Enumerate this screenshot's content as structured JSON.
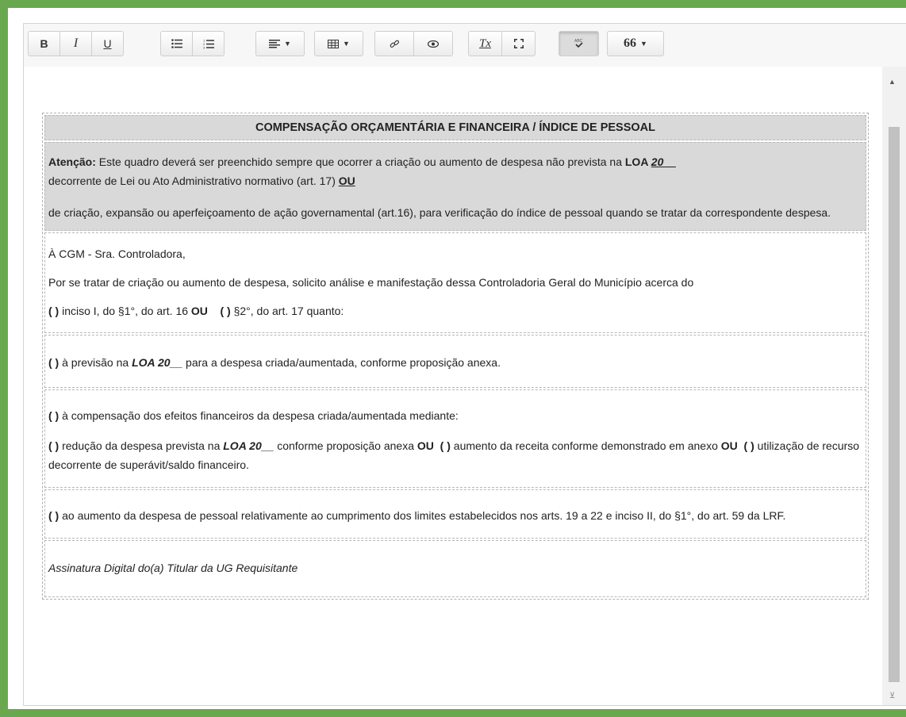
{
  "toolbar": {
    "bold": "B",
    "italic": "I",
    "underline": "U",
    "bulleted_list_icon": "list-ul-icon",
    "numbered_list_icon": "list-ol-icon",
    "align_icon": "align-left-icon",
    "table_icon": "table-icon",
    "link_icon": "link-icon",
    "preview_icon": "eye-icon",
    "clear_format": "Tx",
    "fullscreen_icon": "expand-icon",
    "spellcheck_icon": "spellcheck-icon",
    "quote": "66"
  },
  "document": {
    "title": "COMPENSAÇÃO ORÇAMENTÁRIA E FINANCEIRA / ÍNDICE DE PESSOAL",
    "attention": {
      "label": "Atenção:",
      "text1": " Este quadro deverá ser preenchido sempre que ocorrer a criação ou aumento de despesa não prevista na ",
      "loa_label": "LOA ",
      "loa_year": "20__",
      "text2": "decorrente de Lei ou Ato Administrativo normativo (art. 17)  ",
      "ou": "OU",
      "paragraph2": "de criação, expansão ou aperfeiçoamento de ação governamental (art.16), para verificação do índice de pessoal quando se tratar da correspondente despesa."
    },
    "request": {
      "salutation": "À CGM - Sra. Controladora,",
      "intro": "Por se tratar de criação ou aumento de despesa, solicito análise e manifestação dessa Controladoria Geral do Município acerca do",
      "opt_a_box": "( )",
      "opt_a": " inciso I, do §1°, do art. 16   ",
      "or": "OU",
      "opt_b_box": "( )",
      "opt_b": " §2°, do art. 17 quanto:"
    },
    "forecast": {
      "box": "( )",
      "text1": " à previsão na ",
      "loa": "LOA 20__",
      "text2": "  para a despesa criada/aumentada, conforme proposição anexa."
    },
    "compensation": {
      "box": "( )",
      "line1": " à compensação dos efeitos financeiros da despesa criada/aumentada mediante:",
      "box2": "( )",
      "text_a": " redução da despesa prevista na ",
      "loa": "LOA 20__",
      "text_b": " conforme proposição anexa  ",
      "or1": "OU",
      "box3": "(  )",
      "text_c": " aumento da receita conforme demonstrado em anexo   ",
      "or2": "OU",
      "box4": "( )",
      "text_d": " utilização de recurso decorrente de superávit/saldo financeiro."
    },
    "personnel": {
      "box": "( )",
      "text": " ao aumento da despesa de pessoal relativamente ao cumprimento dos limites estabelecidos nos arts. 19 a 22 e inciso II, do §1°, do art. 59 da LRF."
    },
    "signature": "Assinatura Digital do(a) Titular da UG Requisitante"
  },
  "colors": {
    "frame": "#6aa84f",
    "gray_block": "#d9d9d9"
  }
}
